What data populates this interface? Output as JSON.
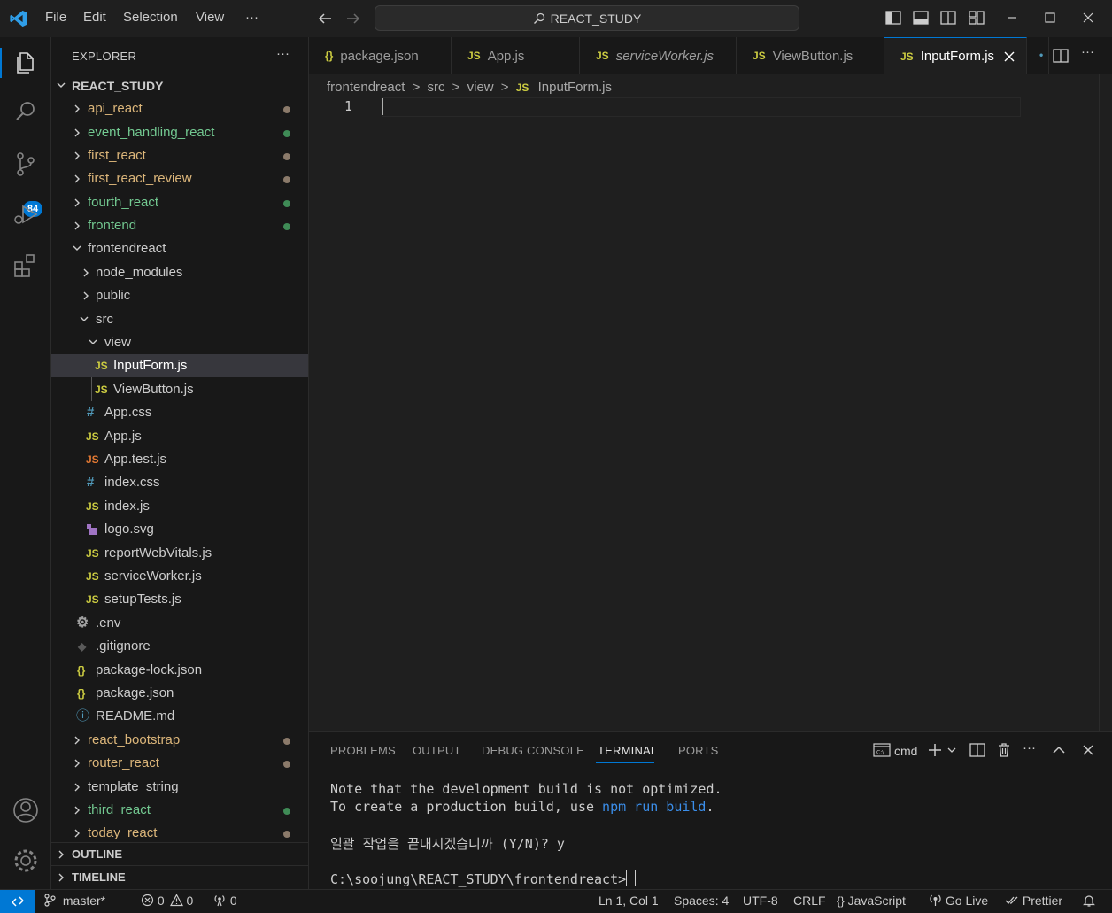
{
  "menu": {
    "file": "File",
    "edit": "Edit",
    "selection": "Selection",
    "view": "View",
    "more": "···"
  },
  "command_center": {
    "label": "REACT_STUDY"
  },
  "source_control_badge": "84",
  "sidebar": {
    "header": "EXPLORER",
    "more": "···",
    "workspace": "REACT_STUDY",
    "items": [
      {
        "label": "api_react"
      },
      {
        "label": "event_handling_react"
      },
      {
        "label": "first_react"
      },
      {
        "label": "first_react_review"
      },
      {
        "label": "fourth_react"
      },
      {
        "label": "frontend"
      },
      {
        "label": "frontendreact"
      },
      {
        "label": "node_modules"
      },
      {
        "label": "public"
      },
      {
        "label": "src"
      },
      {
        "label": "view"
      },
      {
        "label": "InputForm.js"
      },
      {
        "label": "ViewButton.js"
      },
      {
        "label": "App.css"
      },
      {
        "label": "App.js"
      },
      {
        "label": "App.test.js"
      },
      {
        "label": "index.css"
      },
      {
        "label": "index.js"
      },
      {
        "label": "logo.svg"
      },
      {
        "label": "reportWebVitals.js"
      },
      {
        "label": "serviceWorker.js"
      },
      {
        "label": "setupTests.js"
      },
      {
        "label": ".env"
      },
      {
        "label": ".gitignore"
      },
      {
        "label": "package-lock.json"
      },
      {
        "label": "package.json"
      },
      {
        "label": "README.md"
      },
      {
        "label": "react_bootstrap"
      },
      {
        "label": "router_react"
      },
      {
        "label": "template_string"
      },
      {
        "label": "third_react"
      },
      {
        "label": "today_react"
      }
    ],
    "outline": "OUTLINE",
    "timeline": "TIMELINE"
  },
  "icons": {
    "js": "JS",
    "json": "{}",
    "css": "#",
    "info": "ⓘ",
    "gear": "⚙",
    "git": "◆"
  },
  "tabs": [
    {
      "label": "package.json"
    },
    {
      "label": "App.js"
    },
    {
      "label": "serviceWorker.js"
    },
    {
      "label": "ViewButton.js"
    },
    {
      "label": "InputForm.js"
    }
  ],
  "breadcrumb": {
    "p1": "frontendreact",
    "p2": "src",
    "p3": "view",
    "p4": "InputForm.js",
    "sep": ">"
  },
  "editor": {
    "line_number": "1"
  },
  "panel": {
    "tabs": [
      "PROBLEMS",
      "OUTPUT",
      "DEBUG CONSOLE",
      "TERMINAL",
      "PORTS"
    ],
    "shell": "cmd",
    "lines": {
      "l1": "Note that the development build is not optimized.",
      "l2a": "To create a production build, use ",
      "l2b": "npm run build",
      "l2c": ".",
      "l3": "일괄 작업을 끝내시겠습니까 (Y/N)? y",
      "l4": "C:\\soojung\\REACT_STUDY\\frontendreact>"
    }
  },
  "status": {
    "branch": "master*",
    "errors": "0",
    "warnings": "0",
    "ports": "0",
    "position": "Ln 1, Col 1",
    "spaces": "Spaces: 4",
    "encoding": "UTF-8",
    "eol": "CRLF",
    "language": "JavaScript",
    "golive": "Go Live",
    "prettier": "Prettier"
  },
  "colors": {
    "accent": "#0078d4",
    "js": "#cbcb41",
    "js_orange": "#e37933",
    "json": "#cbcb41",
    "css": "#519aba",
    "git_green": "#73c991",
    "untracked_dot": "#8b7a6a",
    "added_dot": "#3f8b56"
  }
}
